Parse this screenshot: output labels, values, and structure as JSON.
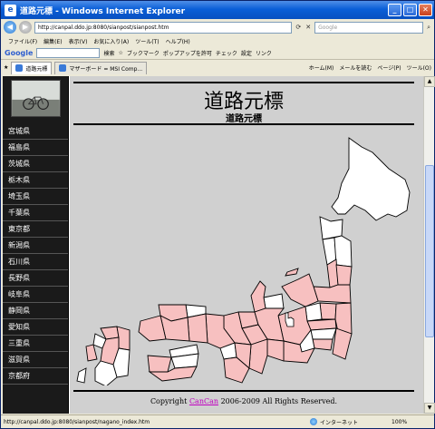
{
  "window": {
    "title": "道路元標 - Windows Internet Explorer",
    "minimize": "_",
    "maximize": "□",
    "close": "✕"
  },
  "address": {
    "url": "http://canpal.ddo.jp:8080/sianpost/sianpost.htm",
    "search_placeholder": "Google"
  },
  "menu": [
    "ファイル(F)",
    "編集(E)",
    "表示(V)",
    "お気に入り(A)",
    "ツール(T)",
    "ヘルプ(H)"
  ],
  "google_bar": {
    "logo": "Google",
    "search": "検索",
    "bookmark": "ブックマーク",
    "popup": "ポップアップを許可",
    "check": "チェック",
    "settings": "設定",
    "link": "リンク"
  },
  "tabs": [
    {
      "label": "道路元標",
      "active": true
    },
    {
      "label": "マザーボード = MSI Comp...",
      "active": false
    }
  ],
  "tab_tools": [
    "ホーム(M)",
    "メールを読む",
    "ページ(P)",
    "ツール(O)"
  ],
  "sidebar": {
    "prefectures": [
      "宮城県",
      "福島県",
      "茨城県",
      "栃木県",
      "埼玉県",
      "千葉県",
      "東京都",
      "新潟県",
      "石川県",
      "長野県",
      "岐阜県",
      "静岡県",
      "愛知県",
      "三重県",
      "滋賀県",
      "京都府"
    ]
  },
  "page": {
    "title": "道路元標",
    "subtitle": "道路元標"
  },
  "footer": {
    "prefix": "Copyright ",
    "link": "CanCan",
    "suffix": " 2006-2009 All Rights Reserved."
  },
  "status": {
    "text": "http://canpal.ddo.jp:8080/sianpost/nagano_index.htm",
    "zone": "インターネット",
    "zoom": "100%"
  },
  "colors": {
    "visited": "#f7c0c0",
    "unvisited": "#ffffff",
    "border": "#000000"
  }
}
